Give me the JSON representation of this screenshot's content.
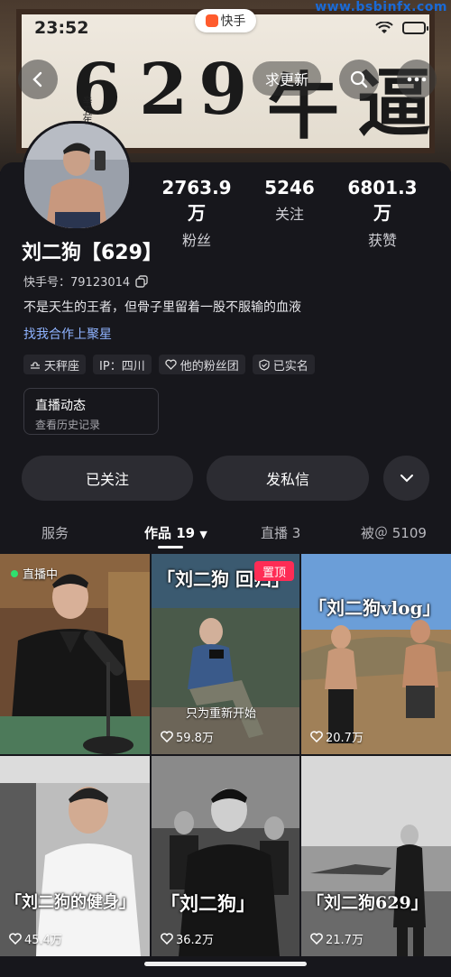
{
  "status": {
    "time": "23:52",
    "app_name": "快手",
    "watermark": "www.bsbinfx.com"
  },
  "hero": {
    "calligraphy": [
      "6",
      "2",
      "9",
      "牛",
      "逼"
    ],
    "seal_text": "辛丑年"
  },
  "header": {
    "want_update": "求更新"
  },
  "profile": {
    "name": "刘二狗【629】",
    "kuaishou_id": "快手号：79123014",
    "bio": "不是天生的王者，但骨子里留着一股不服输的血液",
    "coop_link": "找我合作上聚星",
    "stats": [
      {
        "value": "2763.9万",
        "label": "粉丝"
      },
      {
        "value": "5246",
        "label": "关注"
      },
      {
        "value": "6801.3万",
        "label": "获赞"
      }
    ],
    "tags": [
      "天秤座",
      "IP：四川",
      "他的粉丝团",
      "已实名"
    ],
    "live_card": {
      "title": "直播动态",
      "subtitle": "查看历史记录"
    }
  },
  "actions": {
    "followed": "已关注",
    "message": "发私信"
  },
  "tabs": [
    {
      "label": "服务"
    },
    {
      "label": "作品 19"
    },
    {
      "label": "直播 3"
    },
    {
      "label": "被＠ 5109"
    }
  ],
  "videos": [
    {
      "badge": "直播中",
      "likes": ""
    },
    {
      "caption": "「刘二狗 回归」",
      "pinned": "置顶",
      "subtitle": "只为重新开始",
      "likes": "59.8万"
    },
    {
      "caption": "「刘二狗vlog」",
      "likes": "20.7万"
    },
    {
      "caption": "「刘二狗的健身」",
      "likes": "45.4万"
    },
    {
      "caption": "「刘二狗」",
      "likes": "36.2万"
    },
    {
      "caption": "「刘二狗629」",
      "likes": "21.7万"
    }
  ],
  "colors": {
    "background": "#17171c",
    "pinned": "#fe2c55",
    "link": "#8fb3ff",
    "live_dot": "#2fe06e"
  }
}
